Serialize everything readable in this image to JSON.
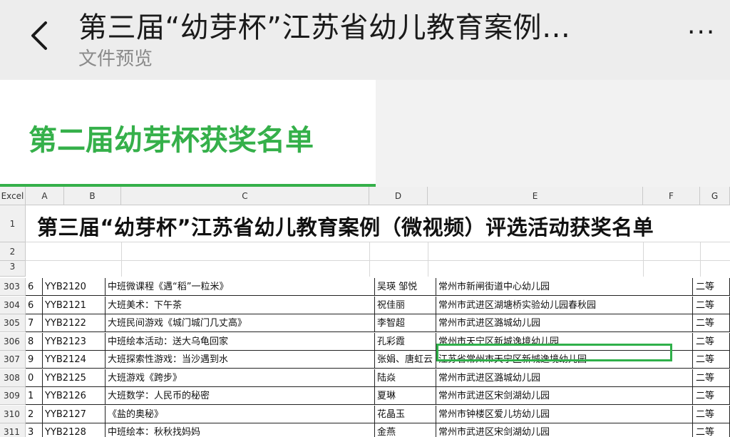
{
  "header": {
    "title": "第三届“幼芽杯”江苏省幼儿教育案例…",
    "subtitle": "文件预览",
    "more": "···"
  },
  "tab": {
    "label": "第二届幼芽杯获奖名单"
  },
  "sheet": {
    "corner": "Excel",
    "columns": [
      "A",
      "B",
      "C",
      "D",
      "E",
      "F",
      "G"
    ],
    "top_rows": [
      "1",
      "2",
      "3"
    ],
    "big_title": "第三届“幼芽杯”江苏省幼儿教育案例（微视频）评选活动获奖名单",
    "rows": [
      {
        "num": "303",
        "a": "6",
        "b": "YYB2120",
        "c": "中班微课程《遇“稻”一粒米》",
        "d": "吴瑛 邹悦",
        "e": "常州市新闸街道中心幼儿园",
        "g": "二等"
      },
      {
        "num": "304",
        "a": "6",
        "b": "YYB2121",
        "c": "大班美术：下午茶",
        "d": "祝佳丽",
        "e": "常州市武进区湖塘桥实验幼儿园春秋园",
        "g": "二等"
      },
      {
        "num": "305",
        "a": "7",
        "b": "YYB2122",
        "c": "大班民间游戏《城门城门几丈高》",
        "d": "李智超",
        "e": "常州市武进区潞城幼儿园",
        "g": "二等"
      },
      {
        "num": "306",
        "a": "8",
        "b": "YYB2123",
        "c": "中班绘本活动：送大乌龟回家",
        "d": "孔彩霞",
        "e": "常州市天宁区新城逸境幼儿园",
        "g": "二等"
      },
      {
        "num": "307",
        "a": "9",
        "b": "YYB2124",
        "c": "大班探索性游戏：当沙遇到水",
        "d": "张娟、唐虹云",
        "e": "江苏省常州市天宁区新城逸境幼儿园",
        "g": "二等"
      },
      {
        "num": "308",
        "a": "0",
        "b": "YYB2125",
        "c": "大班游戏《跨步》",
        "d": "陆焱",
        "e": "常州市武进区潞城幼儿园",
        "g": "二等"
      },
      {
        "num": "309",
        "a": "1",
        "b": "YYB2126",
        "c": "大班数学：人民币的秘密",
        "d": "夏琳",
        "e": "常州市武进区宋剑湖幼儿园",
        "g": "二等"
      },
      {
        "num": "310",
        "a": "2",
        "b": "YYB2127",
        "c": "《盐的奥秘》",
        "d": "花晶玉",
        "e": "常州市钟楼区爱儿坊幼儿园",
        "g": "二等"
      },
      {
        "num": "311",
        "a": "3",
        "b": "YYB2128",
        "c": "中班绘本：秋秋找妈妈",
        "d": "金燕",
        "e": "常州市武进区宋剑湖幼儿园",
        "g": "二等"
      }
    ]
  }
}
